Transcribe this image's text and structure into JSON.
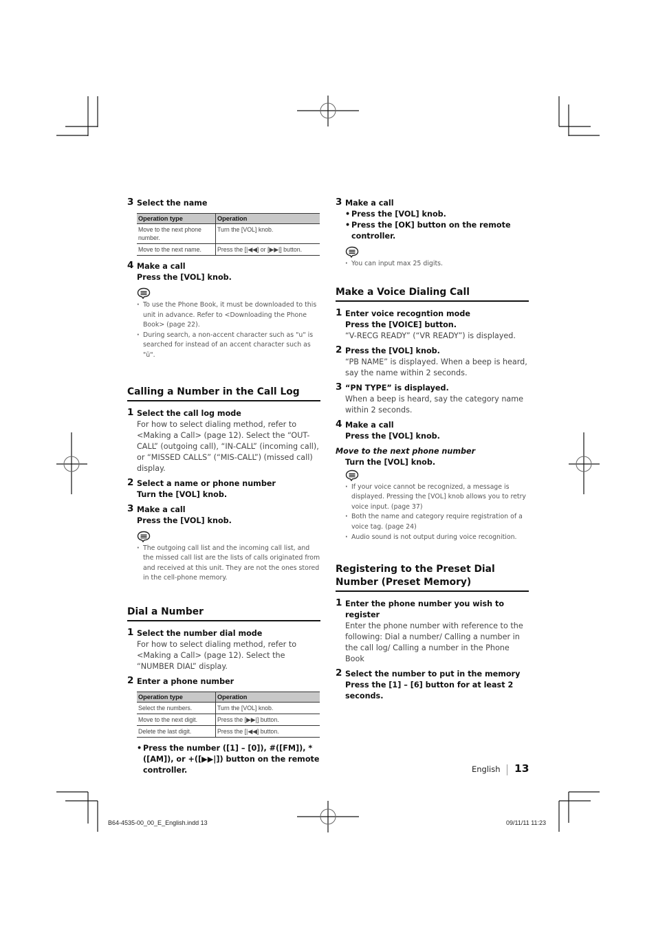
{
  "left_column": {
    "select_name": {
      "num": "3",
      "title": "Select the name",
      "table": {
        "headers": [
          "Operation type",
          "Operation"
        ],
        "rows": [
          [
            "Move to the next phone number.",
            "Turn the [VOL] knob."
          ],
          [
            "Move to the next name.",
            "Press the [|◀◀] or [▶▶|] button."
          ]
        ]
      }
    },
    "make_call_4": {
      "num": "4",
      "title": "Make a call",
      "action": "Press the [VOL] knob.",
      "notes": [
        "To use the Phone Book, it must be downloaded to this unit in advance. Refer to <Downloading the Phone Book> (page 22).",
        "During search, a non-accent character such as \"u\" is searched for instead of an accent character such as \"ü\"."
      ]
    },
    "call_log": {
      "heading": "Calling a Number in the Call Log",
      "steps": [
        {
          "num": "1",
          "title": "Select the call log mode",
          "text": "For how to select dialing method, refer to <Making a Call> (page 12). Select the “OUT-CALL” (outgoing call), “IN-CALL” (incoming call), or “MISSED CALLS” (“MIS-CALL”) (missed call) display."
        },
        {
          "num": "2",
          "title": "Select a name or phone number",
          "action": "Turn the [VOL] knob."
        },
        {
          "num": "3",
          "title": "Make a call",
          "action": "Press the [VOL] knob."
        }
      ],
      "notes": [
        "The outgoing call list and the incoming call list, and the missed call list are the lists of calls originated from and received at this unit. They are not the ones stored in the cell-phone memory."
      ]
    },
    "dial_number": {
      "heading": "Dial a Number",
      "steps": [
        {
          "num": "1",
          "title": "Select the number dial mode",
          "text": "For how to select dialing method, refer to <Making a Call> (page 12). Select the “NUMBER DIAL” display."
        },
        {
          "num": "2",
          "title": "Enter a phone number"
        }
      ],
      "table": {
        "headers": [
          "Operation type",
          "Operation"
        ],
        "rows": [
          [
            "Select the numbers.",
            "Turn the [VOL] knob."
          ],
          [
            "Move to the next digit.",
            "Press the [▶▶|] button."
          ],
          [
            "Delete the last digit.",
            "Press the [|◀◀] button."
          ]
        ]
      },
      "bullet": "Press the number ([1] – [0]), #([FM]), *([AM]), or +([▶▶|]) button on the remote controller."
    }
  },
  "right_column": {
    "make_call_3": {
      "num": "3",
      "title": "Make a call",
      "bullets": [
        "Press the [VOL] knob.",
        "Press the [OK] button on the remote controller."
      ],
      "notes": [
        "You can input max 25 digits."
      ]
    },
    "voice_dialing": {
      "heading": "Make a Voice Dialing Call",
      "steps": [
        {
          "num": "1",
          "title": "Enter voice recogntion mode",
          "action": "Press the [VOICE] button.",
          "text": "“V-RECG READY” (“VR READY”) is displayed."
        },
        {
          "num": "2",
          "title": "Press the [VOL] knob.",
          "text": "“PB NAME” is displayed. When a beep is heard, say the name within 2 seconds."
        },
        {
          "num": "3",
          "title": "“PN TYPE” is displayed.",
          "text": "When a beep is heard, say the category name within 2 seconds."
        },
        {
          "num": "4",
          "title": "Make a call",
          "action": "Press the [VOL] knob."
        }
      ],
      "subhead": "Move to the next phone number",
      "subhead_action": "Turn the [VOL] knob.",
      "notes": [
        "If your voice cannot be recognized, a message is displayed. Pressing the [VOL] knob allows you to retry voice input. (page 37)",
        "Both the name and category require registration of a voice tag. (page 24)",
        "Audio sound is not output during voice recognition."
      ]
    },
    "preset": {
      "heading": "Registering to the Preset Dial Number (Preset Memory)",
      "steps": [
        {
          "num": "1",
          "title": "Enter the phone number you wish to register",
          "text": "Enter the phone number with reference to the following: Dial a number/ Calling a number in the call log/ Calling a number in the Phone Book"
        },
        {
          "num": "2",
          "title": "Select the number to put in the memory",
          "action": "Press the [1] – [6] button for at least 2 seconds."
        }
      ]
    }
  },
  "footer": {
    "language": "English",
    "page_number": "13",
    "slug_file": "B64-4535-00_00_E_English.indd   13",
    "slug_date": "09/11/11   11:23"
  }
}
